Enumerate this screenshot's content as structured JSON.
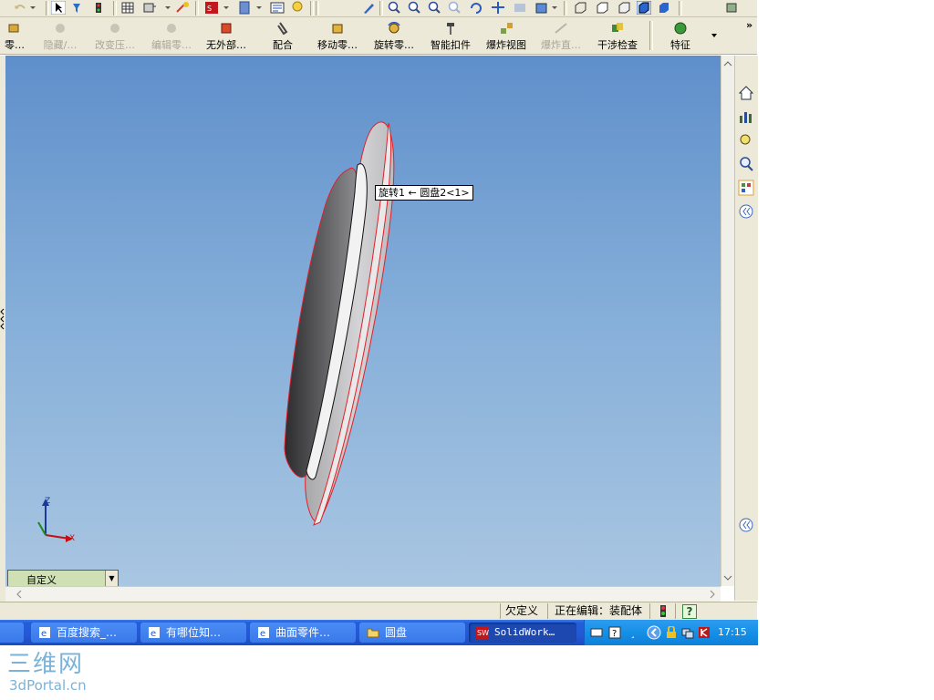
{
  "toolbar2": {
    "items": [
      {
        "label": "零…",
        "disabled": false
      },
      {
        "label": "隐藏/…",
        "disabled": true
      },
      {
        "label": "改变压…",
        "disabled": true
      },
      {
        "label": "编辑零…",
        "disabled": true
      },
      {
        "label": "无外部…",
        "disabled": false
      },
      {
        "label": "配合",
        "disabled": false
      },
      {
        "label": "移动零…",
        "disabled": false
      },
      {
        "label": "旋转零…",
        "disabled": false
      },
      {
        "label": "智能扣件",
        "disabled": false
      },
      {
        "label": "爆炸视图",
        "disabled": false
      },
      {
        "label": "爆炸直…",
        "disabled": true
      },
      {
        "label": "干涉检查",
        "disabled": false
      },
      {
        "label": "特征",
        "disabled": false
      }
    ],
    "overflow": "»"
  },
  "viewport": {
    "tooltip": "旋转1 ← 圆盘2<1>",
    "triad": {
      "z": "Z",
      "x": "X"
    },
    "view_selector": "自定义"
  },
  "status": {
    "underdefined": "欠定义",
    "editing": "正在编辑：装配体",
    "help": "?"
  },
  "taskbar": {
    "tasks": [
      {
        "label": "百度搜索_…"
      },
      {
        "label": "有哪位知…"
      },
      {
        "label": "曲面零件…"
      },
      {
        "label": "圆盘"
      },
      {
        "label": "SolidWork…"
      }
    ],
    "clock": "17:15"
  },
  "watermark": {
    "line1": "三维网",
    "line2": "3dPortal.cn"
  },
  "colors": {
    "taskbar": "#245edb",
    "viewport_top": "#5f8fcb",
    "viewport_bottom": "#a9c6e2",
    "edge": "#e0202a"
  }
}
